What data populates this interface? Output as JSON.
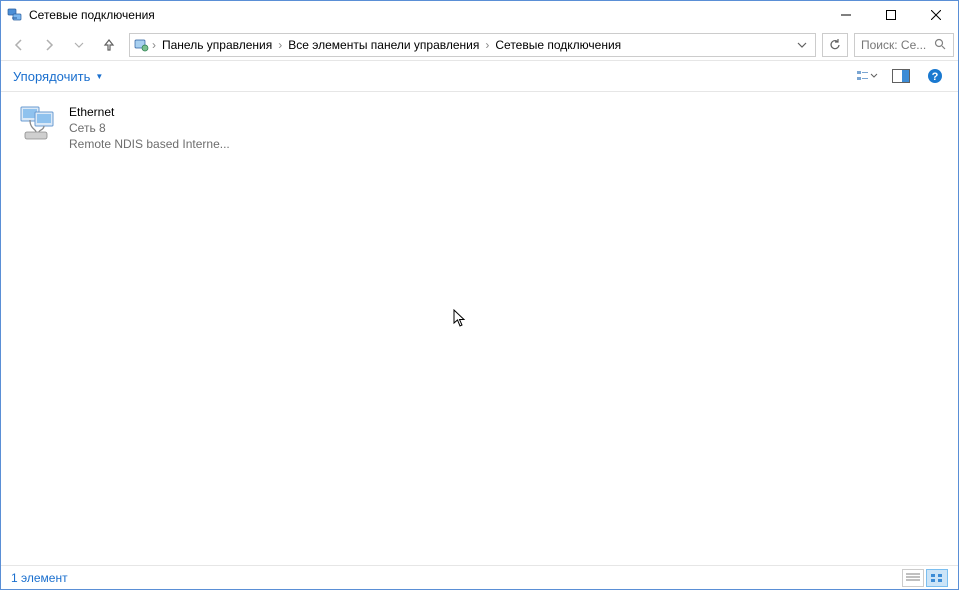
{
  "title": "Сетевые подключения",
  "breadcrumbs": {
    "b1": "Панель управления",
    "b2": "Все элементы панели управления",
    "b3": "Сетевые подключения"
  },
  "search": {
    "placeholder": "Поиск: Се..."
  },
  "toolbar": {
    "organize_label": "Упорядочить"
  },
  "adapter": {
    "name": "Ethernet",
    "network": "Сеть 8",
    "device": "Remote NDIS based Interne..."
  },
  "status": {
    "count_text": "1 элемент"
  }
}
